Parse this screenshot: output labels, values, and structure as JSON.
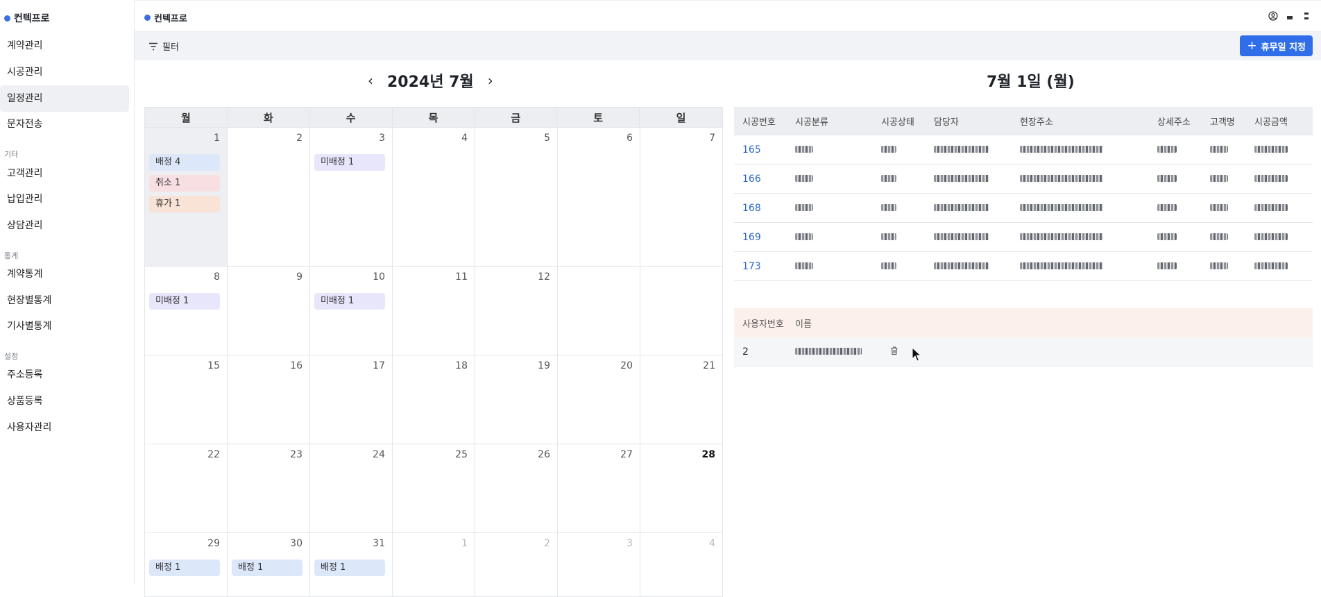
{
  "app": {
    "name": "컨텍프로",
    "accent": "#2f6ee8"
  },
  "sidebar": {
    "items": [
      {
        "label": "계약관리"
      },
      {
        "label": "시공관리"
      },
      {
        "label": "일정관리",
        "active": true
      },
      {
        "label": "문자전송"
      }
    ],
    "sections": [
      {
        "title": "기타",
        "items": [
          "고객관리",
          "납입관리",
          "상담관리"
        ]
      },
      {
        "title": "통계",
        "items": [
          "계약통계",
          "현장별통계",
          "기사별통계"
        ]
      },
      {
        "title": "설정",
        "items": [
          "주소등록",
          "상품등록",
          "사용자관리"
        ]
      }
    ]
  },
  "header": {
    "icons": [
      "user-circle-icon",
      "window-icon",
      "menu-icon"
    ]
  },
  "toolbar": {
    "filter_label": "필터",
    "add_label": "휴무일 지정"
  },
  "calendar": {
    "title": "2024년 7월",
    "weekdays": [
      "월",
      "화",
      "수",
      "목",
      "금",
      "토",
      "일"
    ],
    "weeks": [
      [
        {
          "d": "1",
          "sel": true,
          "ev": [
            {
              "t": "배정 4",
              "c": "#dce7fa"
            },
            {
              "t": "취소 1",
              "c": "#f8dfe2"
            },
            {
              "t": "휴가 1",
              "c": "#f8e3d6"
            }
          ]
        },
        {
          "d": "2"
        },
        {
          "d": "3",
          "ev": [
            {
              "t": "미배정 1",
              "c": "#e8e6fb"
            }
          ]
        },
        {
          "d": "4"
        },
        {
          "d": "5"
        },
        {
          "d": "6"
        },
        {
          "d": "7"
        }
      ],
      [
        {
          "d": "8",
          "ev": [
            {
              "t": "미배정 1",
              "c": "#e8e6fb"
            }
          ]
        },
        {
          "d": "9"
        },
        {
          "d": "10",
          "ev": [
            {
              "t": "미배정 1",
              "c": "#e8e6fb"
            }
          ]
        },
        {
          "d": "11"
        },
        {
          "d": "12"
        },
        {
          "d": ""
        },
        {
          "d": ""
        }
      ],
      [
        {
          "d": "15"
        },
        {
          "d": "16"
        },
        {
          "d": "17"
        },
        {
          "d": "18"
        },
        {
          "d": "19"
        },
        {
          "d": "20"
        },
        {
          "d": "21"
        }
      ],
      [
        {
          "d": "22"
        },
        {
          "d": "23"
        },
        {
          "d": "24"
        },
        {
          "d": "25"
        },
        {
          "d": "26"
        },
        {
          "d": "27"
        },
        {
          "d": "28",
          "bold": true
        }
      ],
      [
        {
          "d": "29",
          "ev": [
            {
              "t": "배정 1",
              "c": "#dce7fa"
            }
          ]
        },
        {
          "d": "30",
          "ev": [
            {
              "t": "배정 1",
              "c": "#dce7fa"
            }
          ]
        },
        {
          "d": "31",
          "ev": [
            {
              "t": "배정 1",
              "c": "#dce7fa"
            }
          ]
        },
        {
          "d": "1",
          "muted": true
        },
        {
          "d": "2",
          "muted": true
        },
        {
          "d": "3",
          "muted": true
        },
        {
          "d": "4",
          "muted": true
        }
      ]
    ]
  },
  "detail": {
    "title": "7월 1일 (월)",
    "columns": [
      "시공번호",
      "시공분류",
      "시공상태",
      "담당자",
      "현장주소",
      "상세주소",
      "고객명",
      "시공금액"
    ],
    "rows": [
      {
        "id": "165"
      },
      {
        "id": "166"
      },
      {
        "id": "168"
      },
      {
        "id": "169"
      },
      {
        "id": "173"
      }
    ]
  },
  "users": {
    "columns": [
      "사용자번호",
      "이름"
    ],
    "rows": [
      {
        "id": "2"
      }
    ]
  }
}
